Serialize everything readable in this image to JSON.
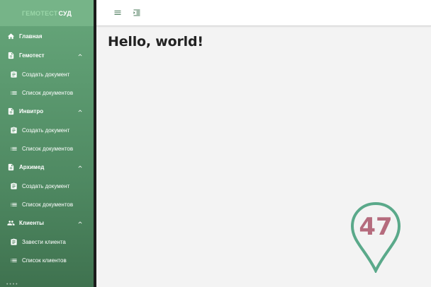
{
  "brand": {
    "part1": "ГЕМОТЕСТ",
    "part2": "СУД"
  },
  "sidebar": {
    "home": {
      "label": "Главная",
      "icon": "home-icon"
    },
    "groups": [
      {
        "label": "Гемотест",
        "icon": "file-icon",
        "items": [
          {
            "label": "Создать документ",
            "icon": "clipboard-icon"
          },
          {
            "label": "Список документов",
            "icon": "list-icon"
          }
        ]
      },
      {
        "label": "Инвитро",
        "icon": "file-icon",
        "items": [
          {
            "label": "Создать документ",
            "icon": "clipboard-icon"
          },
          {
            "label": "Список документов",
            "icon": "list-icon"
          }
        ]
      },
      {
        "label": "Архимед",
        "icon": "file-icon",
        "items": [
          {
            "label": "Создать документ",
            "icon": "clipboard-icon"
          },
          {
            "label": "Список документов",
            "icon": "list-icon"
          }
        ]
      },
      {
        "label": "Клиенты",
        "icon": "people-icon",
        "items": [
          {
            "label": "Завести клиента",
            "icon": "clipboard-icon"
          },
          {
            "label": "Список клиентов",
            "icon": "list-icon"
          }
        ]
      }
    ]
  },
  "toolbar": {
    "menu_icon": "menu-icon",
    "collapse_icon": "indent-icon"
  },
  "main": {
    "heading": "Hello, world!"
  },
  "badge": {
    "number": "47",
    "ring_color": "#5aa98a",
    "number_color": "#b56b7d"
  },
  "colors": {
    "sidebar_top": "#67a77b",
    "sidebar_bottom": "#3f724f",
    "accent": "#4a7a5a"
  }
}
